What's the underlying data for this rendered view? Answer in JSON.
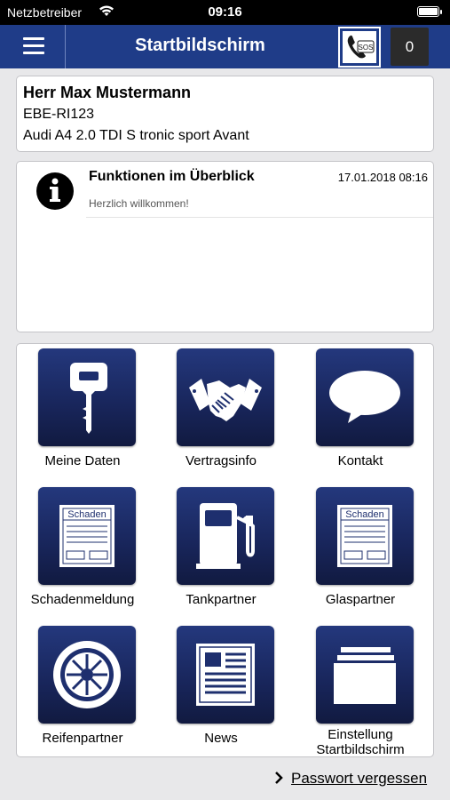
{
  "status_bar": {
    "carrier": "Netzbetreiber",
    "time": "09:16",
    "wifi_icon": "wifi-icon",
    "battery_icon": "battery-icon"
  },
  "nav": {
    "menu_icon": "hamburger-menu-icon",
    "title": "Startbildschirm",
    "sos_label": "SOS",
    "sos_icon": "phone-sos-icon",
    "counter": "0"
  },
  "profile": {
    "name": "Herr Max Mustermann",
    "plate": "EBE-RI123",
    "car": "Audi A4 2.0 TDI S tronic sport Avant"
  },
  "message": {
    "icon": "info-icon",
    "title": "Funktionen im Überblick",
    "date": "17.01.2018 08:16",
    "text": "Herzlich willkommen!"
  },
  "tiles": [
    {
      "label": "Meine Daten",
      "icon": "key-icon"
    },
    {
      "label": "Vertragsinfo",
      "icon": "handshake-icon"
    },
    {
      "label": "Kontakt",
      "icon": "speech-bubble-icon"
    },
    {
      "label": "Schadenmeldung",
      "icon": "damage-form-icon",
      "form_text": "Schaden"
    },
    {
      "label": "Tankpartner",
      "icon": "fuel-pump-icon"
    },
    {
      "label": "Glaspartner",
      "icon": "glass-form-icon",
      "form_text": "Schaden"
    },
    {
      "label": "Reifenpartner",
      "icon": "tire-icon"
    },
    {
      "label": "News",
      "icon": "newspaper-icon"
    },
    {
      "label_line1": "Einstellung",
      "label_line2": "Startbildschirm",
      "icon": "cards-stack-icon"
    }
  ],
  "footer": {
    "password_link": "Passwort vergessen",
    "chevron_icon": "chevron-right-icon"
  },
  "colors": {
    "nav_background": "#1f3c88",
    "tile_background": "#1a2a63",
    "page_background": "#e8e8ea"
  }
}
